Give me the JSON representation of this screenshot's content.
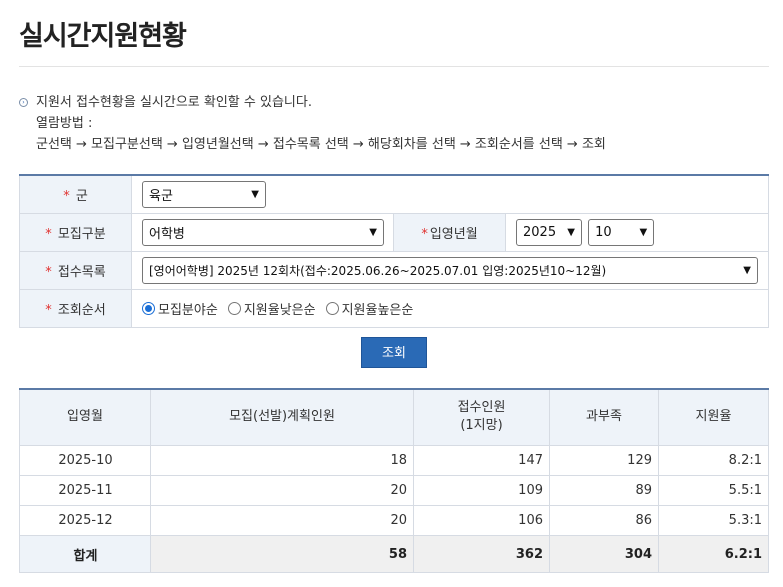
{
  "page": {
    "title": "실시간지원현황"
  },
  "notice": {
    "bullet_icon": "circle-arrow-icon",
    "line1": "지원서 접수현황을 실시간으로 확인할 수 있습니다.",
    "line2": "열람방법 :",
    "line3": "군선택 → 모집구분선택 → 입영년월선택 → 접수목록 선택 → 해당회차를 선택 → 조회순서를 선택 → 조회"
  },
  "form": {
    "required_mark": "*",
    "branch": {
      "label": "군",
      "value": "육군"
    },
    "recruit_type": {
      "label": "모집구분",
      "value": "어학병"
    },
    "enlist_date": {
      "label": "입영년월",
      "year": "2025",
      "month": "10"
    },
    "application_list": {
      "label": "접수목록",
      "value": "[영어어학병] 2025년 12회차(접수:2025.06.26~2025.07.01 입영:2025년10~12월)"
    },
    "sort_order": {
      "label": "조회순서",
      "options": [
        "모집분야순",
        "지원율낮은순",
        "지원율높은순"
      ],
      "selected": "모집분야순"
    }
  },
  "search_button": {
    "label": "조회"
  },
  "results": {
    "headers": {
      "month": "입영월",
      "planned": "모집(선발)계획인원",
      "received_line1": "접수인원",
      "received_line2": "(1지망)",
      "surplus": "과부족",
      "rate": "지원율"
    },
    "rows": [
      {
        "month": "2025-10",
        "planned": "18",
        "received": "147",
        "surplus": "129",
        "rate": "8.2:1"
      },
      {
        "month": "2025-11",
        "planned": "20",
        "received": "109",
        "surplus": "89",
        "rate": "5.5:1"
      },
      {
        "month": "2025-12",
        "planned": "20",
        "received": "106",
        "surplus": "86",
        "rate": "5.3:1"
      }
    ],
    "total": {
      "label": "합계",
      "planned": "58",
      "received": "362",
      "surplus": "304",
      "rate": "6.2:1"
    }
  },
  "colors": {
    "accent": "#2a6ab6",
    "required": "#e0312f",
    "header_bg": "#eef3f9"
  }
}
